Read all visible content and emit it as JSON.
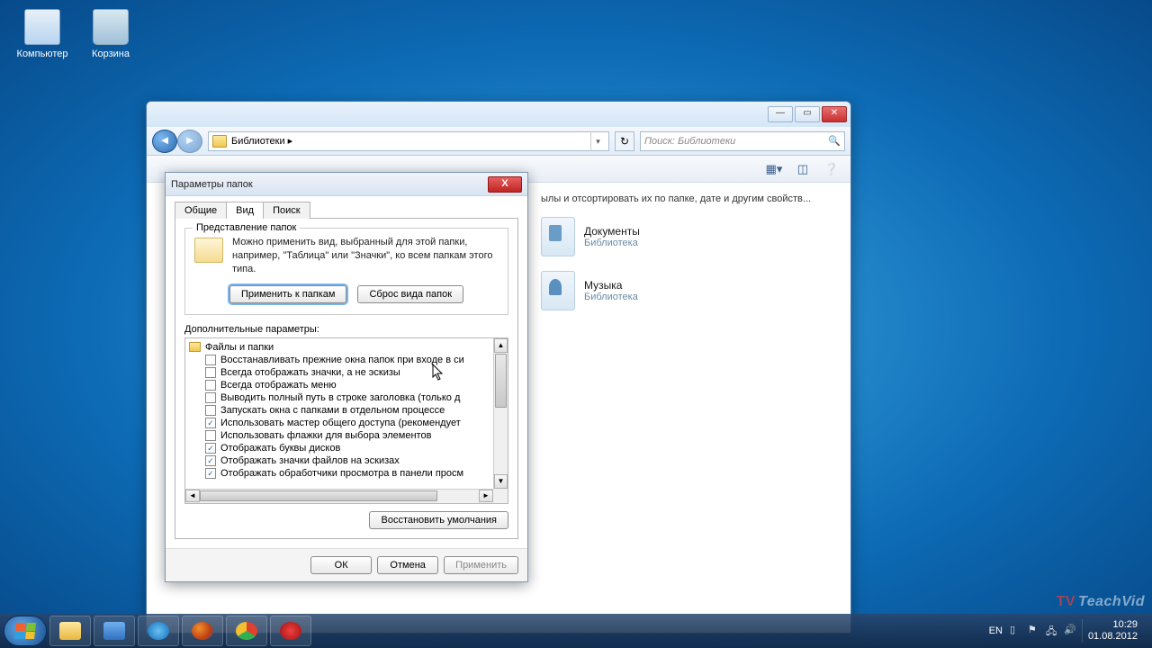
{
  "desktop": {
    "computer": "Компьютер",
    "recycle_bin": "Корзина"
  },
  "explorer": {
    "breadcrumb": "Библиотеки  ▸",
    "search_placeholder": "Поиск: Библиотеки",
    "hint": "ылы и отсортировать их по папке, дате и другим свойств...",
    "libs": {
      "docs": {
        "title": "Документы",
        "sub": "Библиотека"
      },
      "music": {
        "title": "Музыка",
        "sub": "Библиотека"
      }
    }
  },
  "dialog": {
    "title": "Параметры папок",
    "tabs": {
      "general": "Общие",
      "view": "Вид",
      "search": "Поиск"
    },
    "group": {
      "label": "Представление папок",
      "text": "Можно применить вид, выбранный для этой папки, например, \"Таблица\" или \"Значки\", ко всем папкам этого типа.",
      "apply": "Применить к папкам",
      "reset": "Сброс вида папок"
    },
    "adv_label": "Дополнительные параметры:",
    "root": "Файлы и папки",
    "items": [
      {
        "c": false,
        "t": "Восстанавливать прежние окна папок при входе в си"
      },
      {
        "c": false,
        "t": "Всегда отображать значки, а не эскизы"
      },
      {
        "c": false,
        "t": "Всегда отображать меню"
      },
      {
        "c": false,
        "t": "Выводить полный путь в строке заголовка (только д"
      },
      {
        "c": false,
        "t": "Запускать окна с папками в отдельном процессе"
      },
      {
        "c": true,
        "t": "Использовать мастер общего доступа (рекомендует"
      },
      {
        "c": false,
        "t": "Использовать флажки для выбора элементов"
      },
      {
        "c": true,
        "t": "Отображать буквы дисков"
      },
      {
        "c": true,
        "t": "Отображать значки файлов на эскизах"
      },
      {
        "c": true,
        "t": "Отображать обработчики просмотра в панели просм"
      }
    ],
    "restore": "Восстановить умолчания",
    "ok": "ОК",
    "cancel": "Отмена",
    "apply": "Применить"
  },
  "taskbar": {
    "lang": "EN",
    "time": "10:29",
    "date": "01.08.2012"
  },
  "watermark": "TeachVid"
}
